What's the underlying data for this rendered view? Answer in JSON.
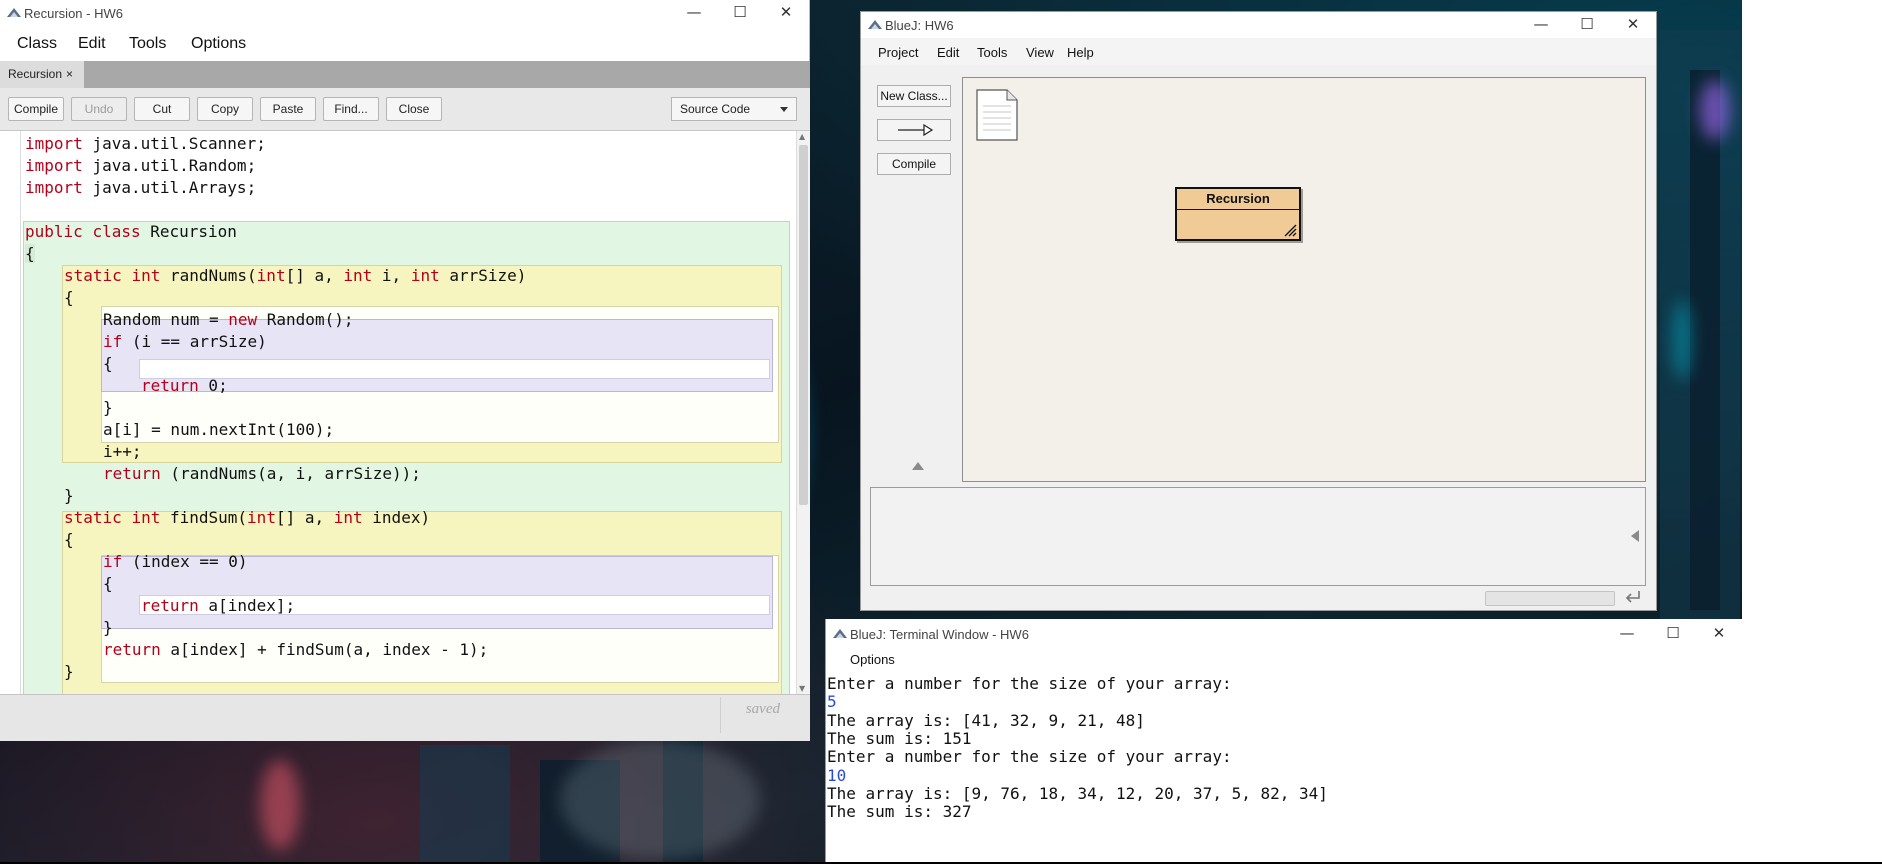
{
  "editor": {
    "title": "Recursion - HW6",
    "menu": [
      "Class",
      "Edit",
      "Tools",
      "Options"
    ],
    "tab_label": "Recursion",
    "tab_close": "×",
    "toolbar": {
      "compile": "Compile",
      "undo": "Undo",
      "cut": "Cut",
      "copy": "Copy",
      "paste": "Paste",
      "find": "Find...",
      "close": "Close",
      "view_select": "Source Code"
    },
    "code": [
      "import java.util.Scanner;",
      "import java.util.Random;",
      "import java.util.Arrays;",
      "",
      "public class Recursion",
      "{",
      "static int randNums(int[] a, int i, int arrSize)",
      "{",
      "Random num = new Random();",
      "if (i == arrSize)",
      "{",
      "return 0;",
      "}",
      "a[i] = num.nextInt(100);",
      "i++;",
      "return (randNums(a, i, arrSize));",
      "}",
      "static int findSum(int[] a, int index)",
      "{",
      "if (index == 0)",
      "{",
      "return a[index];",
      "}",
      "return a[index] + findSum(a, index - 1);",
      "}"
    ],
    "status": "saved"
  },
  "bluej": {
    "title": "BlueJ:  HW6",
    "menu": [
      "Project",
      "Edit",
      "Tools",
      "View",
      "Help"
    ],
    "new_class_button": "New Class...",
    "compile_button": "Compile",
    "class_name": "Recursion"
  },
  "terminal": {
    "title": "BlueJ: Terminal Window - HW6",
    "menu": [
      "Options"
    ],
    "lines": [
      {
        "text": "Enter a number for the size of your array:",
        "kind": "output"
      },
      {
        "text": "5",
        "kind": "input"
      },
      {
        "text": "The array is: [41, 32, 9, 21, 48]",
        "kind": "output"
      },
      {
        "text": "The sum is: 151",
        "kind": "output"
      },
      {
        "text": "Enter a number for the size of your array:",
        "kind": "output"
      },
      {
        "text": "10",
        "kind": "input"
      },
      {
        "text": "The array is: [9, 76, 18, 34, 12, 20, 37, 5, 82, 34]",
        "kind": "output"
      },
      {
        "text": "The sum is: 327",
        "kind": "output"
      }
    ]
  },
  "window_controls": {
    "minimize": "—",
    "maximize": "☐",
    "close": "✕"
  },
  "colors": {
    "keyword": "#b3001b",
    "class_scope": "#e2f6e4",
    "method_scope": "#f6f4bf",
    "if_scope": "#e6e4f5",
    "class_box": "#f0cb96",
    "terminal_input": "#2a4bd7"
  },
  "icons": [
    "bluej-app-icon",
    "readme-document-icon",
    "inheritance-arrow-icon",
    "return-icon"
  ]
}
